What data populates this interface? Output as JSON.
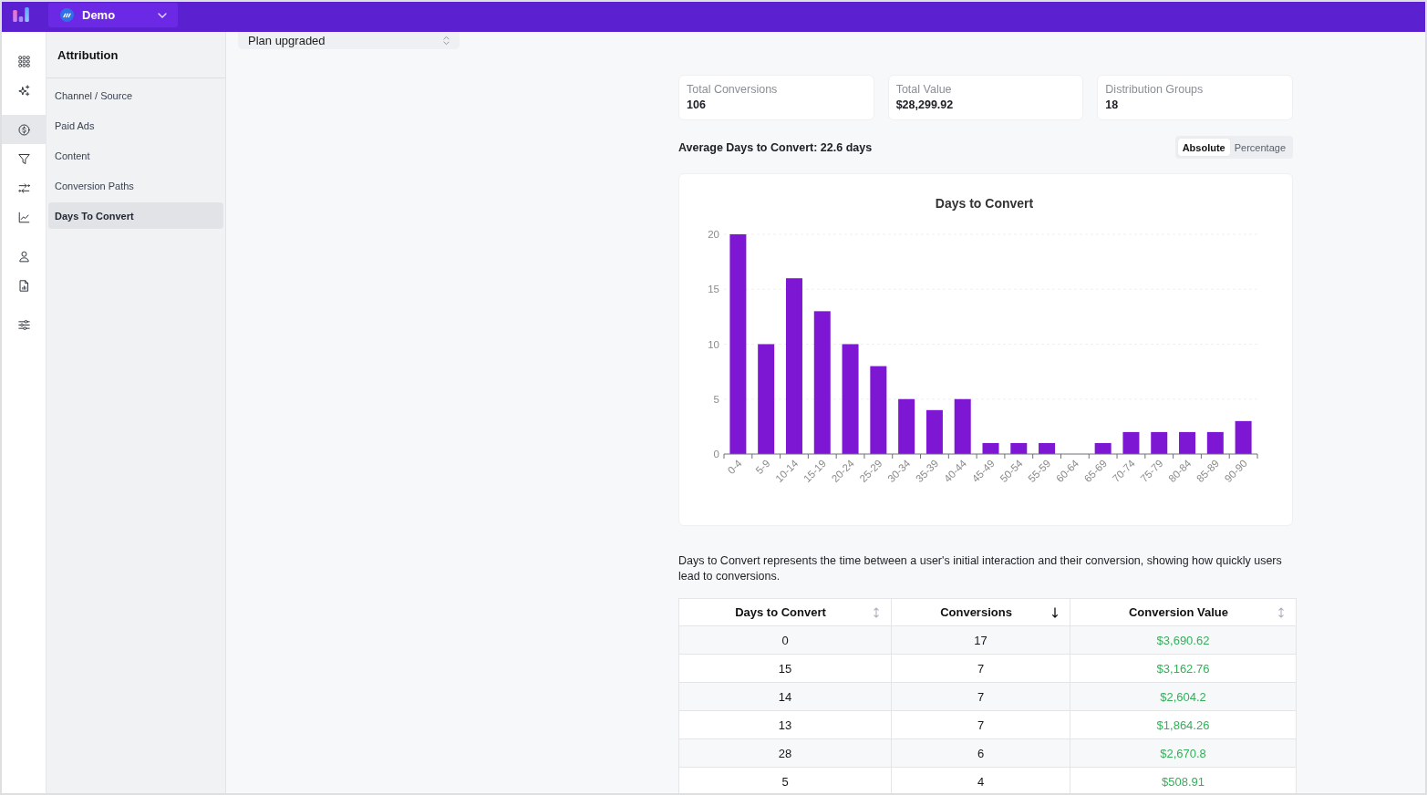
{
  "header": {
    "project_selector": {
      "label": "Demo"
    }
  },
  "icon_rail": {
    "groups": [
      {
        "items": [
          {
            "selected": false
          },
          {
            "selected": false
          }
        ]
      },
      {
        "items": [
          {
            "selected": true
          },
          {
            "selected": false
          },
          {
            "selected": false
          },
          {
            "selected": false
          }
        ]
      },
      {
        "items": [
          {
            "selected": false
          },
          {
            "selected": false
          }
        ]
      },
      {
        "items": [
          {
            "selected": false
          }
        ]
      }
    ]
  },
  "sidebar": {
    "title": "Attribution",
    "items": [
      {
        "label": "Channel / Source",
        "selected": false
      },
      {
        "label": "Paid Ads",
        "selected": false
      },
      {
        "label": "Content",
        "selected": false
      },
      {
        "label": "Conversion Paths",
        "selected": false
      },
      {
        "label": "Days To Convert",
        "selected": true
      }
    ]
  },
  "filter": {
    "value": "Plan upgraded"
  },
  "stats": [
    {
      "label": "Total Conversions",
      "value": "106"
    },
    {
      "label": "Total Value",
      "value": "$28,299.92"
    },
    {
      "label": "Distribution Groups",
      "value": "18"
    }
  ],
  "average": "Average Days to Convert: 22.6 days",
  "view_toggle": [
    {
      "label": "Absolute",
      "selected": true
    },
    {
      "label": "Percentage",
      "selected": false
    }
  ],
  "chart": {
    "chart_data": {
      "type": "bar",
      "title": "Days to Convert",
      "categories": [
        "0-4",
        "5-9",
        "10-14",
        "15-19",
        "20-24",
        "25-29",
        "30-34",
        "35-39",
        "40-44",
        "45-49",
        "50-54",
        "55-59",
        "60-64",
        "65-69",
        "70-74",
        "75-79",
        "80-84",
        "85-89",
        "90-90"
      ],
      "values": [
        20,
        10,
        16,
        13,
        10,
        8,
        5,
        4,
        5,
        1,
        1,
        1,
        0,
        1,
        2,
        2,
        2,
        2,
        3
      ],
      "ylim": [
        0,
        20
      ],
      "yticks": [
        0,
        5,
        10,
        15,
        20
      ],
      "grid": true
    }
  },
  "description": "Days to Convert represents the time between a user's initial interaction and their conversion, showing how quickly users lead to conversions.",
  "table": {
    "columns": [
      {
        "label": "Days to Convert",
        "sorted": false
      },
      {
        "label": "Conversions",
        "sorted": true
      },
      {
        "label": "Conversion Value",
        "sorted": false
      }
    ],
    "rows": [
      [
        "0",
        "17",
        "$3,690.62"
      ],
      [
        "15",
        "7",
        "$3,162.76"
      ],
      [
        "14",
        "7",
        "$2,604.2"
      ],
      [
        "13",
        "7",
        "$1,864.26"
      ],
      [
        "28",
        "6",
        "$2,670.8"
      ],
      [
        "5",
        "4",
        "$508.91"
      ]
    ]
  }
}
